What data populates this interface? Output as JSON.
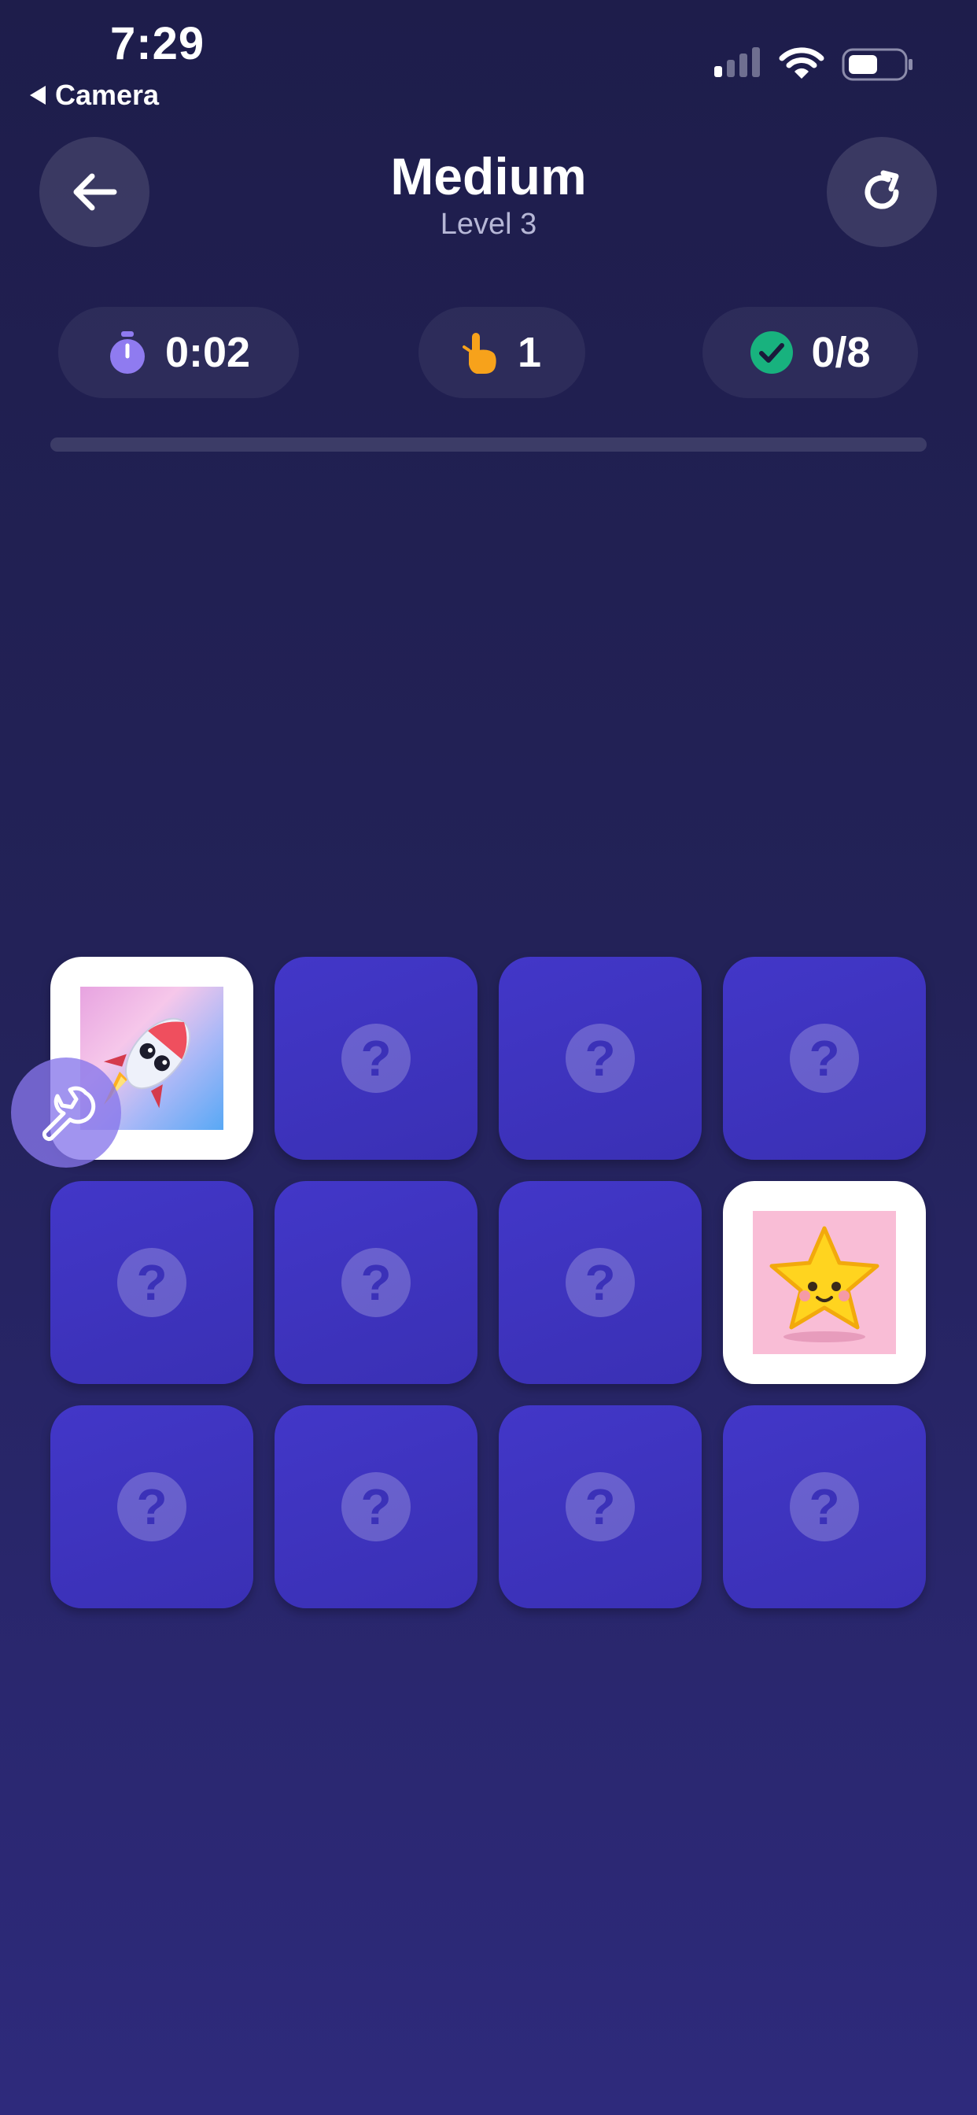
{
  "status_bar": {
    "time": "7:29",
    "back_app_label": "Camera"
  },
  "header": {
    "title": "Medium",
    "subtitle": "Level 3",
    "back_icon": "arrow-left-icon",
    "restart_icon": "refresh-icon"
  },
  "stats": {
    "timer": {
      "icon": "stopwatch-icon",
      "value": "0:02"
    },
    "moves": {
      "icon": "tap-finger-icon",
      "value": "1"
    },
    "matches": {
      "icon": "check-circle-icon",
      "value": "0/8"
    }
  },
  "progress": {
    "fraction": 0
  },
  "board": {
    "rows": 3,
    "cols": 4,
    "hidden_symbol": "?",
    "cards": [
      {
        "state": "revealed",
        "image": "rocket"
      },
      {
        "state": "hidden"
      },
      {
        "state": "hidden"
      },
      {
        "state": "hidden"
      },
      {
        "state": "hidden"
      },
      {
        "state": "hidden"
      },
      {
        "state": "hidden"
      },
      {
        "state": "revealed",
        "image": "star"
      },
      {
        "state": "hidden"
      },
      {
        "state": "hidden"
      },
      {
        "state": "hidden"
      },
      {
        "state": "hidden"
      }
    ]
  },
  "debug_tool": {
    "icon": "wrench-icon"
  },
  "colors": {
    "background_top": "#1e1d4b",
    "background_bottom": "#2e2a7c",
    "card_hidden": "#4237c8",
    "card_revealed": "#ffffff",
    "timer_icon": "#8f7bf0",
    "moves_icon": "#f7a21b",
    "matches_icon": "#18b27e",
    "tool_button": "#8676eb"
  }
}
